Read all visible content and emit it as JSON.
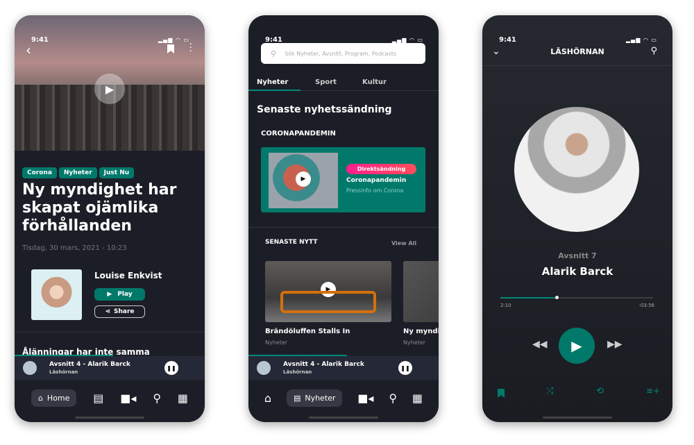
{
  "status_time": "9:41",
  "article": {
    "tags": [
      "Corona",
      "Nyheter",
      "Just Nu"
    ],
    "title": "Ny myndighet har skapat ojämlika förhållanden",
    "date": "Tisdag, 30 mars, 2021 - 10:23",
    "author": "Louise Enkvist",
    "play_label": "Play",
    "share_label": "Share",
    "next_title": "Ålänningar har inte samma"
  },
  "miniplayer": {
    "title": "Avsnitt 4 - Alarik Barck",
    "subtitle": "Läshörnan",
    "progress": 0.52
  },
  "nav": {
    "home": "Home",
    "news": "Nyheter"
  },
  "news": {
    "search_placeholder": "Sök Nyheter, Avsnitt, Program, Podcasts",
    "tabs": [
      "Nyheter",
      "Sport",
      "Kultur"
    ],
    "heading": "Senaste nyhetssändning",
    "section": "CORONAPANDEMIN",
    "live_badge": "Direktsändning",
    "live_title": "Coronapandemin",
    "live_sub": "Pressinfo om Corona",
    "latest": "SENASTE NYTT",
    "view_all": "View All",
    "cards": [
      {
        "title": "Brändöluffen Stalls In",
        "cat": "Nyheter"
      },
      {
        "title": "Ny myndighet",
        "cat": "Nyheter"
      }
    ]
  },
  "player": {
    "header": "LÄSHÖRNAN",
    "episode": "Avsnitt 7",
    "author": "Alarik Barck",
    "elapsed": "2:10",
    "remaining": "-03:56",
    "progress": 0.36
  },
  "colors": {
    "accent": "#00796b",
    "background": "#1c1e27",
    "live": "#ff1f8e"
  }
}
